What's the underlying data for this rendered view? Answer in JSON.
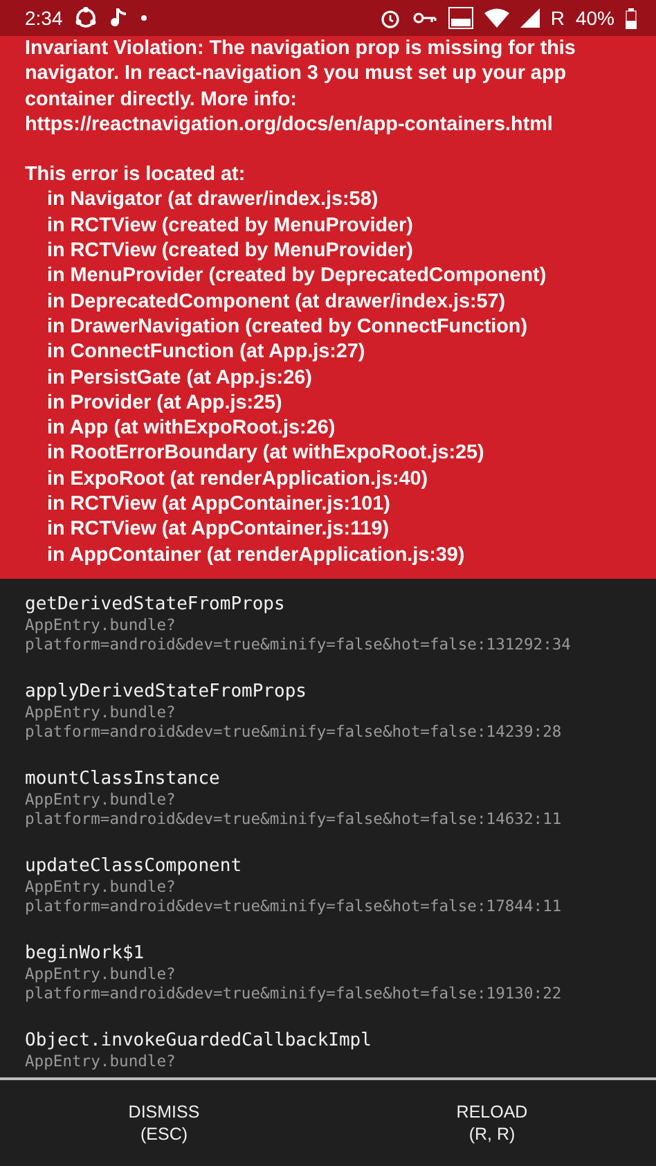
{
  "status_bar": {
    "time": "2:34",
    "network_label": "R",
    "battery": "40%"
  },
  "error": {
    "message": "Invariant Violation: The navigation prop is missing for this navigator. In react-navigation 3 you must set up your app container directly. More info: https://reactnavigation.org/docs/en/app-containers.html",
    "location_heading": "This error is located at:",
    "component_stack": [
      "in Navigator (at drawer/index.js:58)",
      "in RCTView (created by MenuProvider)",
      "in RCTView (created by MenuProvider)",
      "in MenuProvider (created by DeprecatedComponent)",
      "in DeprecatedComponent (at drawer/index.js:57)",
      "in DrawerNavigation (created by ConnectFunction)",
      "in ConnectFunction (at App.js:27)",
      "in PersistGate (at App.js:26)",
      "in Provider (at App.js:25)",
      "in App (at withExpoRoot.js:26)",
      "in RootErrorBoundary (at withExpoRoot.js:25)",
      "in ExpoRoot (at renderApplication.js:40)",
      "in RCTView (at AppContainer.js:101)",
      "in RCTView (at AppContainer.js:119)",
      "in AppContainer (at renderApplication.js:39)"
    ]
  },
  "stack_frames": [
    {
      "method": "getDerivedStateFromProps",
      "file": "AppEntry.bundle?",
      "location": "platform=android&dev=true&minify=false&hot=false:131292:34"
    },
    {
      "method": "applyDerivedStateFromProps",
      "file": "AppEntry.bundle?",
      "location": "platform=android&dev=true&minify=false&hot=false:14239:28"
    },
    {
      "method": "mountClassInstance",
      "file": "AppEntry.bundle?",
      "location": "platform=android&dev=true&minify=false&hot=false:14632:11"
    },
    {
      "method": "updateClassComponent",
      "file": "AppEntry.bundle?",
      "location": "platform=android&dev=true&minify=false&hot=false:17844:11"
    },
    {
      "method": "beginWork$1",
      "file": "AppEntry.bundle?",
      "location": "platform=android&dev=true&minify=false&hot=false:19130:22"
    },
    {
      "method": "Object.invokeGuardedCallbackImpl",
      "file": "AppEntry.bundle?"
    }
  ],
  "buttons": [
    {
      "label": "DISMISS",
      "shortcut": "(ESC)"
    },
    {
      "label": "RELOAD",
      "shortcut": "(R, R)"
    }
  ]
}
